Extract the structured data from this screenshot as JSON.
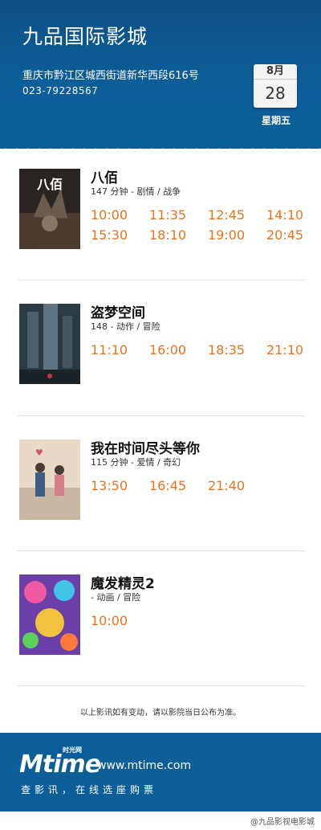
{
  "header": {
    "cinema_name": "九品国际影城",
    "address": "重庆市黔江区城西街道新华西段616号",
    "phone": "023-79228567",
    "date": {
      "month": "8月",
      "day": "28",
      "weekday": "星期五"
    }
  },
  "movies": [
    {
      "title": "八佰",
      "meta": "147 分钟 - 剧情 / 战争",
      "poster_text": "八佰",
      "times": [
        "10:00",
        "11:35",
        "12:45",
        "14:10",
        "15:30",
        "18:10",
        "19:00",
        "20:45"
      ]
    },
    {
      "title": "盗梦空间",
      "meta": "148 - 动作 / 冒险",
      "poster_text": "",
      "times": [
        "11:10",
        "16:00",
        "18:35",
        "21:10"
      ]
    },
    {
      "title": "我在时间尽头等你",
      "meta": "115 分钟 - 爱情 / 奇幻",
      "poster_text": "",
      "times": [
        "13:50",
        "16:45",
        "21:40"
      ]
    },
    {
      "title": "魔发精灵2",
      "meta": "- 动画 / 冒险",
      "poster_text": "",
      "times": [
        "10:00"
      ]
    }
  ],
  "notice": "以上影讯如有变动，请以影院当日公布为准。",
  "footer": {
    "logo": "Mtime",
    "logo_sub": "时光网",
    "url": "www.mtime.com",
    "slogan": "查影讯，在线选座购票"
  },
  "watermark": "@九品影视电影城",
  "colors": {
    "header_blue": "#0b5e98",
    "time_orange": "#e8731a"
  }
}
